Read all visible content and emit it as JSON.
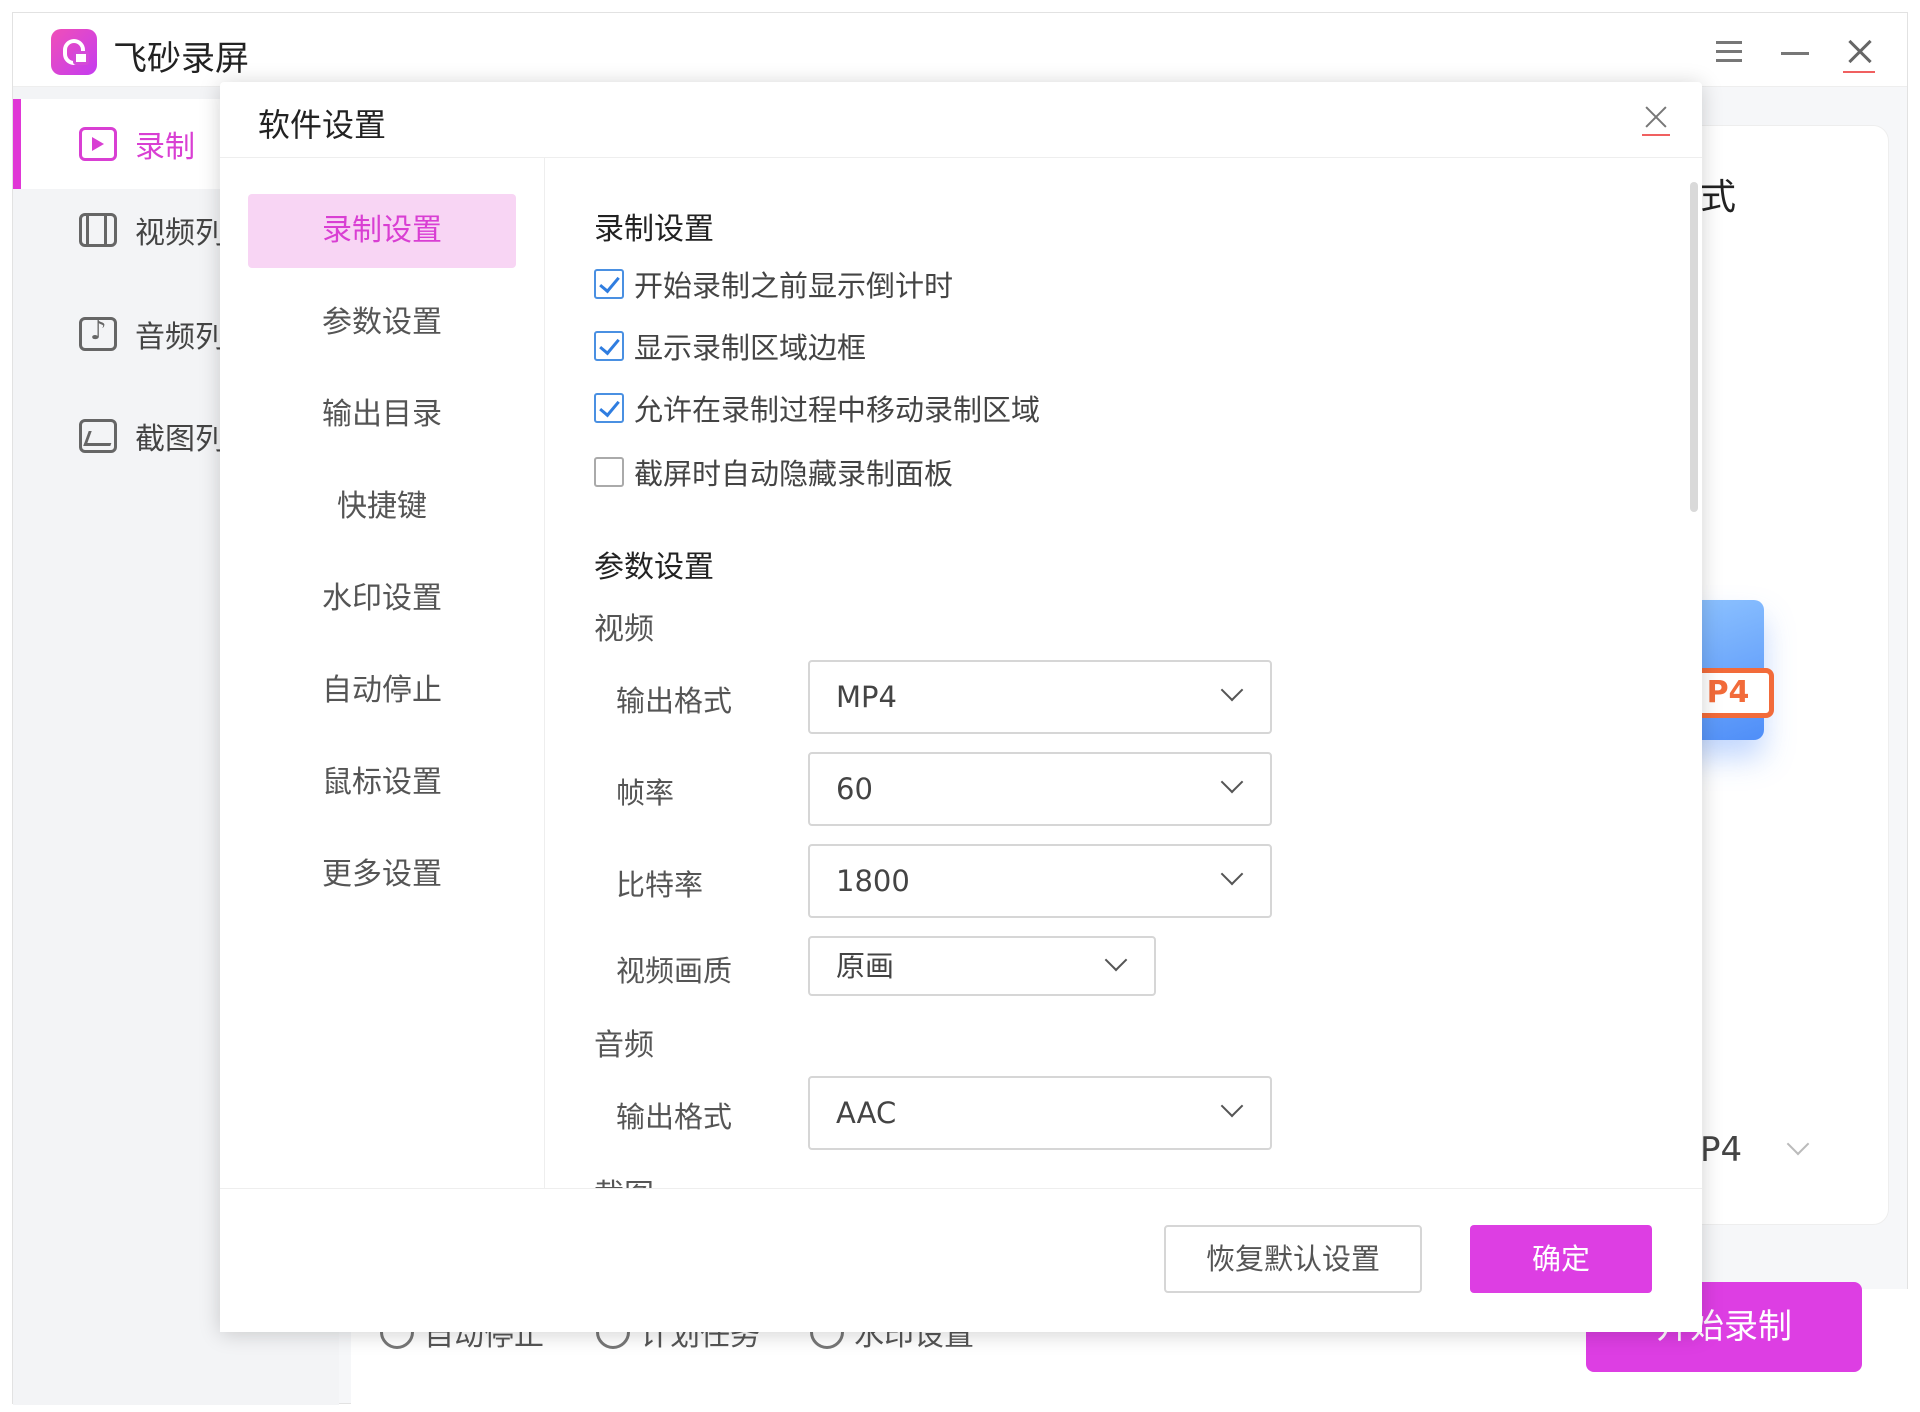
{
  "app": {
    "title": "飞砂录屏",
    "sidebar": {
      "items": [
        {
          "label": "录制",
          "icon": "record-icon",
          "active": true
        },
        {
          "label": "视频列",
          "icon": "video-list-icon",
          "active": false
        },
        {
          "label": "音频列",
          "icon": "audio-list-icon",
          "active": false
        },
        {
          "label": "截图列",
          "icon": "screenshot-list-icon",
          "active": false
        }
      ]
    },
    "background": {
      "format_title_partial": "式",
      "file_badge": "P4",
      "select_value_partial": "P4",
      "bottom_options": [
        "自动停止",
        "计划任务",
        "水印设置"
      ],
      "start_button": "开始录制"
    },
    "accent_color": "#dd3ee3"
  },
  "dialog": {
    "title": "软件设置",
    "nav": [
      {
        "label": "录制设置",
        "active": true
      },
      {
        "label": "参数设置",
        "active": false
      },
      {
        "label": "输出目录",
        "active": false
      },
      {
        "label": "快捷键",
        "active": false
      },
      {
        "label": "水印设置",
        "active": false
      },
      {
        "label": "自动停止",
        "active": false
      },
      {
        "label": "鼠标设置",
        "active": false
      },
      {
        "label": "更多设置",
        "active": false
      }
    ],
    "record_section": {
      "title": "录制设置",
      "options": [
        {
          "label": "开始录制之前显示倒计时",
          "checked": true
        },
        {
          "label": "显示录制区域边框",
          "checked": true
        },
        {
          "label": "允许在录制过程中移动录制区域",
          "checked": true
        },
        {
          "label": "截屏时自动隐藏录制面板",
          "checked": false
        }
      ]
    },
    "param_section": {
      "title": "参数设置",
      "video": {
        "title": "视频",
        "fields": [
          {
            "label": "输出格式",
            "value": "MP4"
          },
          {
            "label": "帧率",
            "value": "60"
          },
          {
            "label": "比特率",
            "value": "1800"
          },
          {
            "label": "视频画质",
            "value": "原画"
          }
        ]
      },
      "audio": {
        "title": "音频",
        "fields": [
          {
            "label": "输出格式",
            "value": "AAC"
          }
        ]
      },
      "screenshot_title_partial": "截图"
    },
    "buttons": {
      "reset": "恢复默认设置",
      "ok": "确定"
    }
  }
}
